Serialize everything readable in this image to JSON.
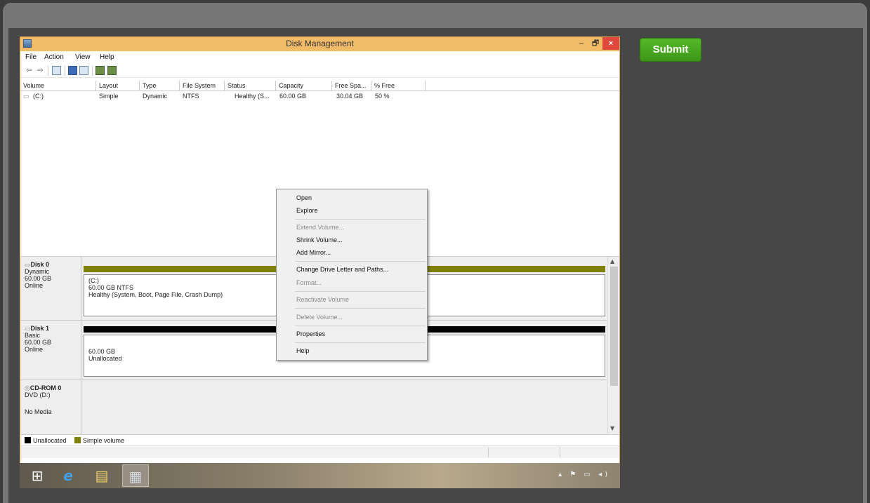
{
  "submit_label": "Submit",
  "window": {
    "title": "Disk Management",
    "minimize_glyph": "–",
    "maximize_glyph": "🗗",
    "close_glyph": "×",
    "menu": [
      "File",
      "Action",
      "View",
      "Help"
    ]
  },
  "toolbar_icons": [
    "back-arrow-icon",
    "forward-arrow-icon",
    "console-icon",
    "help-icon",
    "list-icon",
    "refresh-icon",
    "properties-icon"
  ],
  "volume_table": {
    "columns": [
      "Volume",
      "Layout",
      "Type",
      "File System",
      "Status",
      "Capacity",
      "Free Spa...",
      "% Free"
    ],
    "rows": [
      [
        "(C:)",
        "Simple",
        "Dynamic",
        "NTFS",
        "Healthy (S...",
        "60.00 GB",
        "30.04 GB",
        "50 %"
      ]
    ]
  },
  "disks": [
    {
      "name": "Disk 0",
      "type": "Dynamic",
      "size": "60.00 GB",
      "state": "Online",
      "bar_color": "#808000",
      "partition": {
        "label": "(C:)",
        "detail": "60.00 GB NTFS",
        "status": "Healthy (System, Boot, Page File, Crash Dump)"
      }
    },
    {
      "name": "Disk 1",
      "type": "Basic",
      "size": "60.00 GB",
      "state": "Online",
      "bar_color": "#000000",
      "partition": {
        "detail": "60.00 GB",
        "status": "Unallocated"
      }
    },
    {
      "name": "CD-ROM 0",
      "type": "DVD (D:)",
      "state": "No Media"
    }
  ],
  "legend": [
    {
      "label": "Unallocated",
      "color": "#000000"
    },
    {
      "label": "Simple volume",
      "color": "#808000"
    }
  ],
  "context_menu": {
    "open": "Open",
    "explore": "Explore",
    "extend": "Extend Volume...",
    "shrink": "Shrink Volume...",
    "add_mirror": "Add Mirror...",
    "change_letter": "Change Drive Letter and Paths...",
    "format": "Format...",
    "reactivate": "Reactivate Volume",
    "delete": "Delete Volume...",
    "properties": "Properties",
    "help": "Help"
  }
}
